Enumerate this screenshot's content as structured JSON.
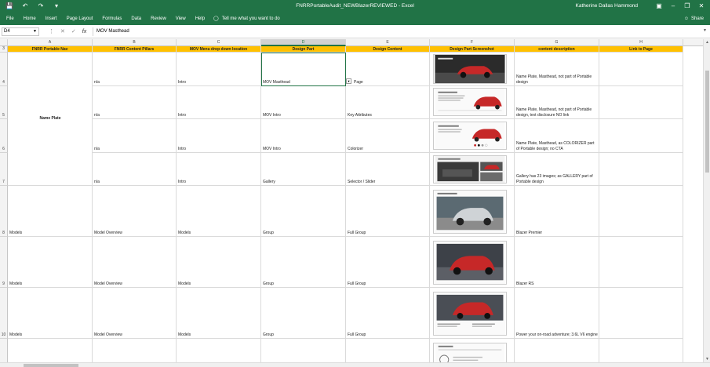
{
  "app": {
    "title": "FNRRPortableAudit_NEWBlazerREVIEWED  -  Excel",
    "user": "Katherine Dallas Hammond",
    "quick_access": [
      "save-icon",
      "undo-icon",
      "redo-icon",
      "customize-icon"
    ],
    "window_controls": [
      "ribbon-display-icon",
      "minimize-icon",
      "restore-icon",
      "close-icon"
    ]
  },
  "ribbon": {
    "tabs": [
      "File",
      "Home",
      "Insert",
      "Page Layout",
      "Formulas",
      "Data",
      "Review",
      "View",
      "Help"
    ],
    "tell_me": "Tell me what you want to do",
    "share": "Share"
  },
  "formula_bar": {
    "name_box": "D4",
    "formula": "MOV Masthead"
  },
  "columns": [
    "A",
    "B",
    "C",
    "D",
    "E",
    "F",
    "G",
    "H"
  ],
  "selected_column": "D",
  "header_row": {
    "row_number": "3",
    "cells": [
      "FNRR Portable Nav",
      "FNRR Content Pillars",
      "MOV Menu drop down location",
      "Design Part",
      "Design Content",
      "Design Part Screenshot",
      "content description",
      "Link to Page"
    ]
  },
  "merged_label": "Name Plate",
  "rows": [
    {
      "num": "4",
      "a": "",
      "b": "n/a",
      "c": "Intro",
      "d": "MOV Masthead",
      "e": "Page",
      "g": "Name Plate, Masthead, not part of Portable design",
      "h": ""
    },
    {
      "num": "5",
      "a": "",
      "b": "n/a",
      "c": "Intro",
      "d": "MOV Intro",
      "e": "Key Attributes",
      "g": "Name Plate, Masthead, not part of Portable design, text disclosure NO link",
      "h": ""
    },
    {
      "num": "6",
      "a": "",
      "b": "n/a",
      "c": "Intro",
      "d": "MOV Intro",
      "e": "Colorizer",
      "g": "Name Plate, Masthead, as COLORIZER part of Portable design; no CTA",
      "h": ""
    },
    {
      "num": "7",
      "a": "",
      "b": "n/a",
      "c": "Intro",
      "d": "Gallery",
      "e": "Selector / Slider",
      "g": "Gallery has 23 images; as GALLERY part of Portable design",
      "h": ""
    },
    {
      "num": "8",
      "a": "Models",
      "b": "Model Overview",
      "c": "Models",
      "d": "Group",
      "e": "Full Group",
      "g": "Blazer Premier",
      "h": ""
    },
    {
      "num": "9",
      "a": "Models",
      "b": "Model Overview",
      "c": "Models",
      "d": "Group",
      "e": "Full Group",
      "g": "Blazer RS",
      "h": ""
    },
    {
      "num": "10",
      "a": "Models",
      "b": "Model Overview",
      "c": "Models",
      "d": "Group",
      "e": "Full Group",
      "g": "Power your on-road adventure; 3.6L V6 engine",
      "h": ""
    },
    {
      "num": "11",
      "a": "",
      "b": "",
      "c": "",
      "d": "",
      "e": "",
      "g": "",
      "h": ""
    }
  ],
  "colors": {
    "excel_green": "#217346",
    "header_fill": "#ffc000",
    "car_red": "#c62828"
  }
}
